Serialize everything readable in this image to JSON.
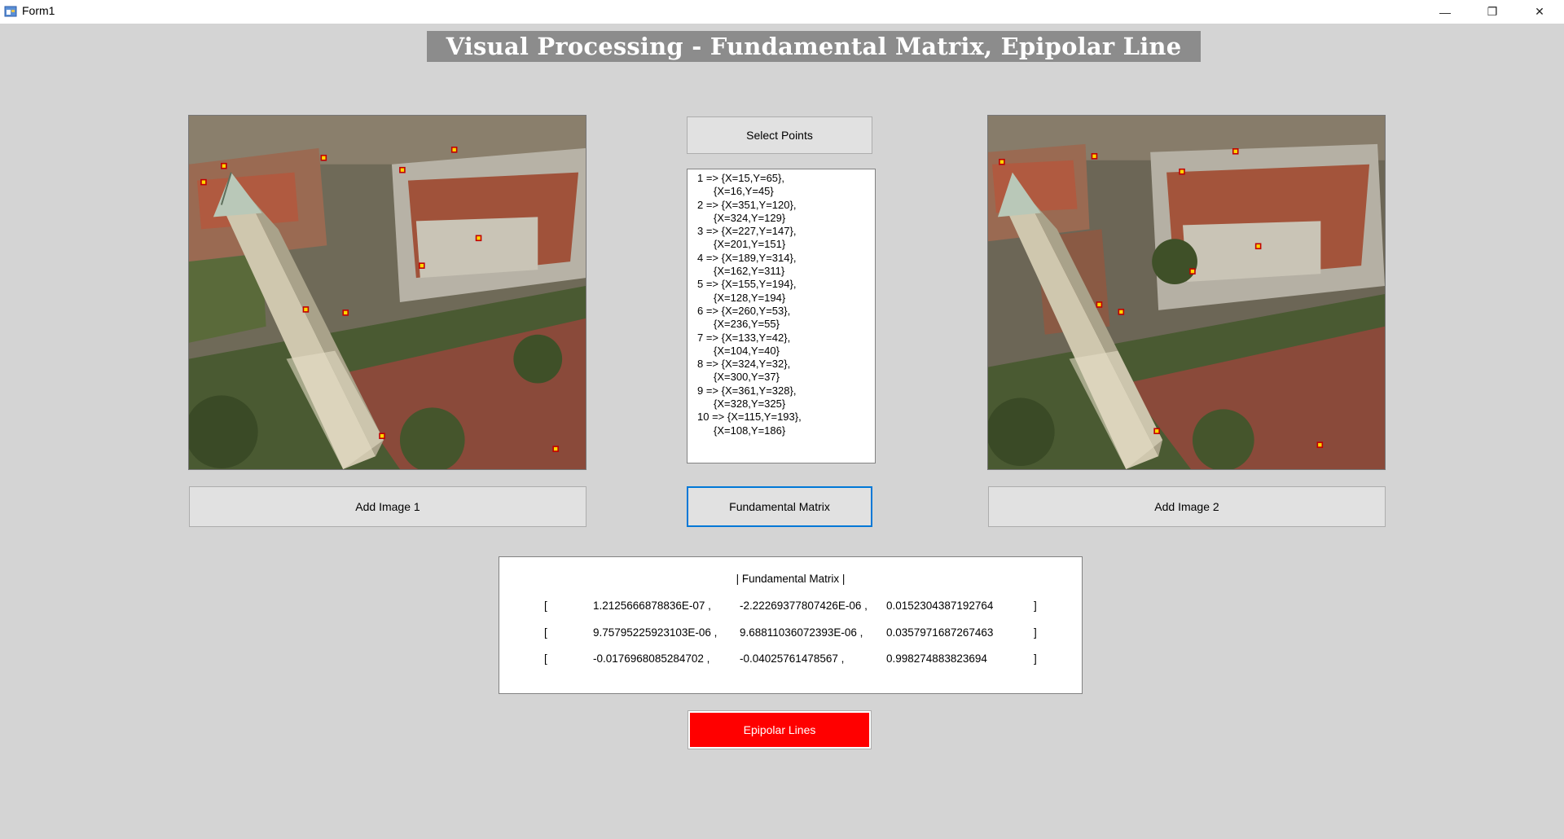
{
  "window": {
    "title": "Form1",
    "minimize": "—",
    "maximize": "❐",
    "close": "✕"
  },
  "banner": "Visual Processing - Fundamental Matrix, Epipolar Line",
  "buttons": {
    "select_points": "Select Points",
    "add_image_1": "Add Image 1",
    "fundamental_matrix": "Fundamental Matrix",
    "add_image_2": "Add Image 2",
    "epipolar_lines": "Epipolar Lines"
  },
  "points_list": [
    {
      "main": "1 => {X=15,Y=65},",
      "sub": "{X=16,Y=45}"
    },
    {
      "main": "2 => {X=351,Y=120},",
      "sub": "{X=324,Y=129}"
    },
    {
      "main": "3 => {X=227,Y=147},",
      "sub": "{X=201,Y=151}"
    },
    {
      "main": "4 => {X=189,Y=314},",
      "sub": "{X=162,Y=311}"
    },
    {
      "main": "5 => {X=155,Y=194},",
      "sub": "{X=128,Y=194}"
    },
    {
      "main": "6 => {X=260,Y=53},",
      "sub": "{X=236,Y=55}"
    },
    {
      "main": "7 => {X=133,Y=42},",
      "sub": "{X=104,Y=40}"
    },
    {
      "main": "8 => {X=324,Y=32},",
      "sub": "{X=300,Y=37}"
    },
    {
      "main": "9 => {X=361,Y=328},",
      "sub": "{X=328,Y=325}"
    },
    {
      "main": "10 => {X=115,Y=193},",
      "sub": "{X=108,Y=186}"
    }
  ],
  "matrix": {
    "title": "| Fundamental Matrix |",
    "open": "[",
    "close": "]",
    "rows": [
      [
        "1.2125666878836E-07 ,",
        "-2.22269377807426E-06 ,",
        "0.0152304387192764"
      ],
      [
        "9.75795225923103E-06 ,",
        "9.68811036072393E-06 ,",
        "0.0357971687267463"
      ],
      [
        "-0.0176968085284702 ,",
        "-0.04025761478567 ,",
        "0.998274883823694"
      ]
    ]
  },
  "colors": {
    "accent": "#0078d7",
    "epipolar_button": "#ff0000",
    "marker_fill": "#ffd600",
    "marker_stroke": "#c00000"
  }
}
